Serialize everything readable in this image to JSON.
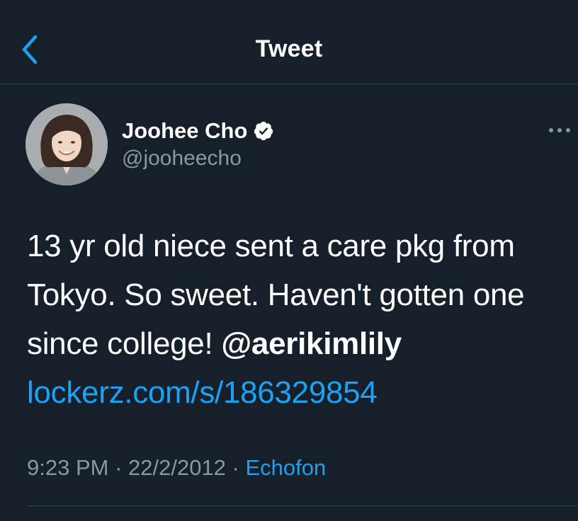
{
  "header": {
    "title": "Tweet",
    "back_icon": "chevron-left-icon"
  },
  "author": {
    "name": "Joohee Cho",
    "handle": "@jooheecho",
    "verified": true,
    "verified_icon": "verified-badge-icon"
  },
  "tweet": {
    "text_line_1": "13 yr old niece sent a care pkg from",
    "text_line_2": "Tokyo. So sweet. Haven't gotten one",
    "text_line_3_prefix": "since college! ",
    "mention": "@aerikimlily",
    "link": "lockerz.com/s/186329854"
  },
  "meta": {
    "time": "9:23 PM",
    "separator": " · ",
    "date": "22/2/2012",
    "separator_2": " · ",
    "source": "Echofon"
  },
  "colors": {
    "background": "#15202b",
    "accent": "#1da1f2",
    "secondary_text": "#8899a6",
    "divider": "#38444d"
  }
}
